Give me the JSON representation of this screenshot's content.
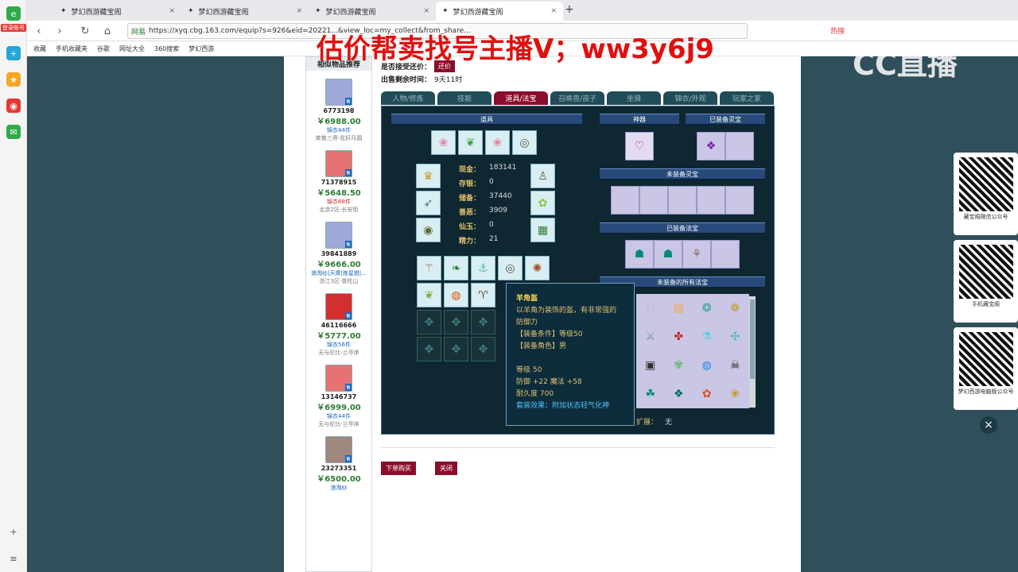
{
  "watermark": "估价帮卖找号主播V；ww3y6j9",
  "cc_logo": "CC直播",
  "leftbar": {
    "badge": "登录账号"
  },
  "tabs": [
    {
      "title": "梦幻西游藏宝阁"
    },
    {
      "title": "梦幻西游藏宝阁"
    },
    {
      "title": "梦幻西游藏宝阁"
    },
    {
      "title": "梦幻西游藏宝阁"
    }
  ],
  "new_tab": "+",
  "address": {
    "secure": "网易",
    "url": "https://xyq.cbg.163.com/equip?s=926&eid=20221...&view_loc=my_collect&from_share..."
  },
  "hot": "热搜",
  "bookmarks": [
    "收藏",
    "手机收藏夹",
    "谷歌",
    "网址大全",
    "360搜索",
    "梦幻西游"
  ],
  "similar": {
    "title": "相似物品推荐",
    "items": [
      {
        "id": "6773198",
        "price": "￥6988.00",
        "cloth": "锦衣44件",
        "server": "笑傲三界-花好月圆",
        "red": false
      },
      {
        "id": "71378915",
        "price": "￥5648.50",
        "cloth": "锦衣68件",
        "server": "北京2区-长安街",
        "red": true
      },
      {
        "id": "39841889",
        "price": "￥9666.00",
        "cloth": "浪淘纱|天摩|炼星蜕|...",
        "server": "浙江3区-普陀山",
        "red": false
      },
      {
        "id": "46116666",
        "price": "￥5777.00",
        "cloth": "锦衣56件",
        "server": "无与伦比-兰亭序",
        "red": false
      },
      {
        "id": "13146737",
        "price": "￥6999.00",
        "cloth": "锦衣44件",
        "server": "无与伦比-兰亭序",
        "red": false
      },
      {
        "id": "23273351",
        "price": "￥6500.00",
        "cloth": "浪淘纱",
        "server": "",
        "red": false
      }
    ]
  },
  "info": {
    "bargain_label": "是否接受还价：",
    "bargain_btn": "还价",
    "time_label": "出售剩余时间：",
    "time_value": "9天11时"
  },
  "detail_tabs": [
    "人物/修炼",
    "技能",
    "道具/法宝",
    "召唤兽/孩子",
    "坐骑",
    "锦衣/外观",
    "玩家之家"
  ],
  "active_tab": 2,
  "panel": {
    "items_header": "道具",
    "shenqi_header": "神器",
    "equipped_lingbao": "已装备灵宝",
    "unequipped_lingbao": "未装备灵宝",
    "equipped_fabao": "已装备法宝",
    "all_fabao": "未装备的所有法宝",
    "expand_label": "扩展：",
    "expand_value": "无",
    "stats": [
      {
        "label": "现金：",
        "value": "183141"
      },
      {
        "label": "存银：",
        "value": "0"
      },
      {
        "label": "储备：",
        "value": "37440"
      },
      {
        "label": "善恶：",
        "value": "3909"
      },
      {
        "label": "仙玉：",
        "value": "0"
      },
      {
        "label": "精力：",
        "value": "21"
      }
    ]
  },
  "tooltip": {
    "name": "羊角盔",
    "desc": "以羊角为装饰的盔，有非常强的",
    "desc2": "防御力",
    "req1": "【装备条件】等级50",
    "req2": "【装备角色】男",
    "level": "等级 50",
    "attrs": "防御 +22 魔法 +58",
    "durability": "耐久度 700",
    "effect": "套装效果：附加状态轻气化神"
  },
  "actions": {
    "buy": "下单购买",
    "close": "关闭"
  },
  "qr": [
    {
      "label": "藏宝阁微信公众号"
    },
    {
      "label": "手机藏宝阁"
    },
    {
      "label": "梦幻西游电脑版公众号"
    }
  ],
  "close_icon": "×"
}
